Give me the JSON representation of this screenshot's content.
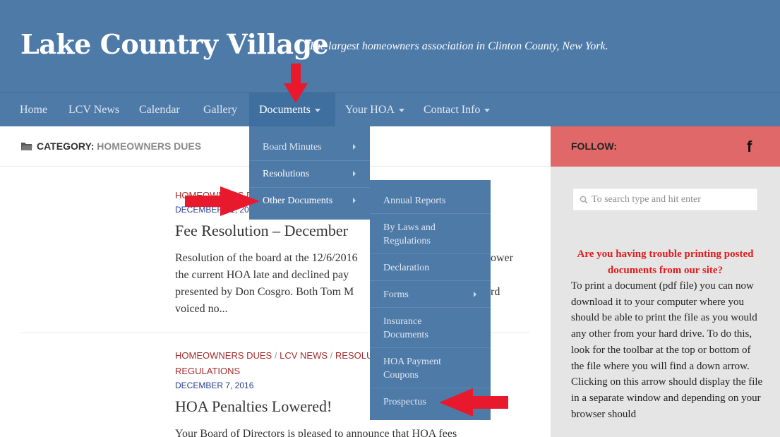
{
  "site": {
    "title": "Lake Country Village",
    "tagline": "The largest homeowners association in Clinton County, New York."
  },
  "nav": {
    "items": [
      {
        "label": "Home"
      },
      {
        "label": "LCV News"
      },
      {
        "label": "Calendar"
      },
      {
        "label": "Gallery"
      },
      {
        "label": "Documents"
      },
      {
        "label": "Your HOA"
      },
      {
        "label": "Contact Info"
      }
    ]
  },
  "documents_menu": {
    "items": [
      {
        "label": "Board Minutes"
      },
      {
        "label": "Resolutions"
      },
      {
        "label": "Other Documents"
      }
    ]
  },
  "other_documents_menu": {
    "items": [
      {
        "label": "Annual Reports"
      },
      {
        "label": "By Laws and Regulations"
      },
      {
        "label": "Declaration"
      },
      {
        "label": "Forms"
      },
      {
        "label": "Insurance Documents"
      },
      {
        "label": "HOA Payment Coupons"
      },
      {
        "label": "Prospectus"
      }
    ]
  },
  "page_heading": {
    "prefix": "CATEGORY:",
    "category": "HOMEOWNERS DUES"
  },
  "posts": [
    {
      "cats": "HOMEOWNERS D",
      "date": "DECEMBER 31, 20",
      "title": "Fee Resolution – December",
      "excerpt_lines": [
        "Resolution of the board at the 12/6/2016",
        "the current HOA late and declined pay",
        "presented by Don Cosgro.  Both Tom M",
        "voiced no..."
      ],
      "excerpt_tails": [
        "ower",
        "",
        "rd",
        ""
      ]
    },
    {
      "cats": [
        "HOMEOWNERS DUES",
        "LCV NEWS",
        "RESOLU",
        "REGULATIONS"
      ],
      "sep": "/",
      "date": "DECEMBER 7, 2016",
      "title": "HOA Penalties Lowered!",
      "excerpt": "Your Board of Directors is pleased to announce that HOA fees"
    }
  ],
  "sidebar": {
    "follow_label": "FOLLOW:",
    "facebook_glyph": "f",
    "search_placeholder": "To search type and hit enter",
    "trouble_heading": "Are you having trouble printing posted documents from our site?",
    "trouble_body": "To print a document (pdf file) you can now download it to your computer where you should be able to print the file as you would any other from your hard drive.  To do this, look for the toolbar at the top or bottom of the file where you will find a down arrow. Clicking on this arrow should display the file in a separate window and depending on your browser should"
  },
  "colors": {
    "header_blue": "#4e7aa8",
    "annotation_red": "#e8192c",
    "follow_red": "#e16868"
  },
  "icons": [
    "folder-icon",
    "facebook-icon",
    "search-icon",
    "caret-down-icon",
    "chevron-right-icon",
    "red-arrow-annotation"
  ]
}
